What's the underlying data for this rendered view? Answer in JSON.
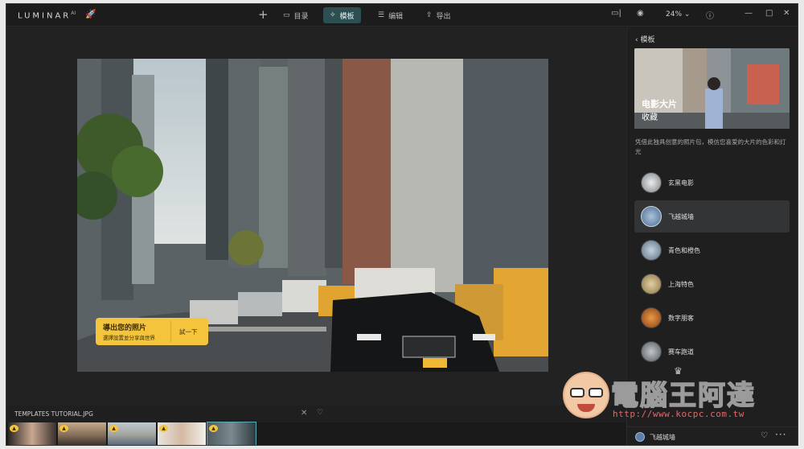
{
  "topbar": {
    "logo": "LUMINAR",
    "logo_sup": "AI",
    "nav": [
      {
        "label": "目录",
        "icon": "folder-icon"
      },
      {
        "label": "模板",
        "icon": "wand-icon",
        "active": true
      },
      {
        "label": "编辑",
        "icon": "sliders-icon"
      },
      {
        "label": "导出",
        "icon": "export-icon"
      }
    ],
    "zoom": "24%"
  },
  "popup": {
    "title": "導出您的照片",
    "subtitle": "選擇設置並分享與世界",
    "action": "試一下"
  },
  "filmstrip": {
    "title": "TEMPLATES TUTORIAL.JPG",
    "thumbs": 5,
    "selected_index": 4
  },
  "panel": {
    "back_label": "模板",
    "hero_title": "电影大片",
    "hero_subtitle": "收藏",
    "description": "凭借此独具创意的照片包，模仿您喜爱的大片的色彩和灯光",
    "templates": [
      {
        "label": "玄黑电影",
        "color": "#cfd3d6"
      },
      {
        "label": "飞越城墙",
        "color": "#6f8fb3",
        "selected": true
      },
      {
        "label": "青色和橙色",
        "color": "#7e94a8"
      },
      {
        "label": "上海特色",
        "color": "#b59a6a"
      },
      {
        "label": "数字朋客",
        "color": "#c26a2a"
      },
      {
        "label": "赛车跑道",
        "color": "#8a8f94"
      }
    ],
    "footer_label": "飞越城墙"
  },
  "watermark": {
    "text": "電腦王阿達",
    "url": "http://www.kocpc.com.tw"
  },
  "colors": {
    "accent": "#2d4f52",
    "popup": "#f3c43c",
    "background": "#1f1f20"
  }
}
